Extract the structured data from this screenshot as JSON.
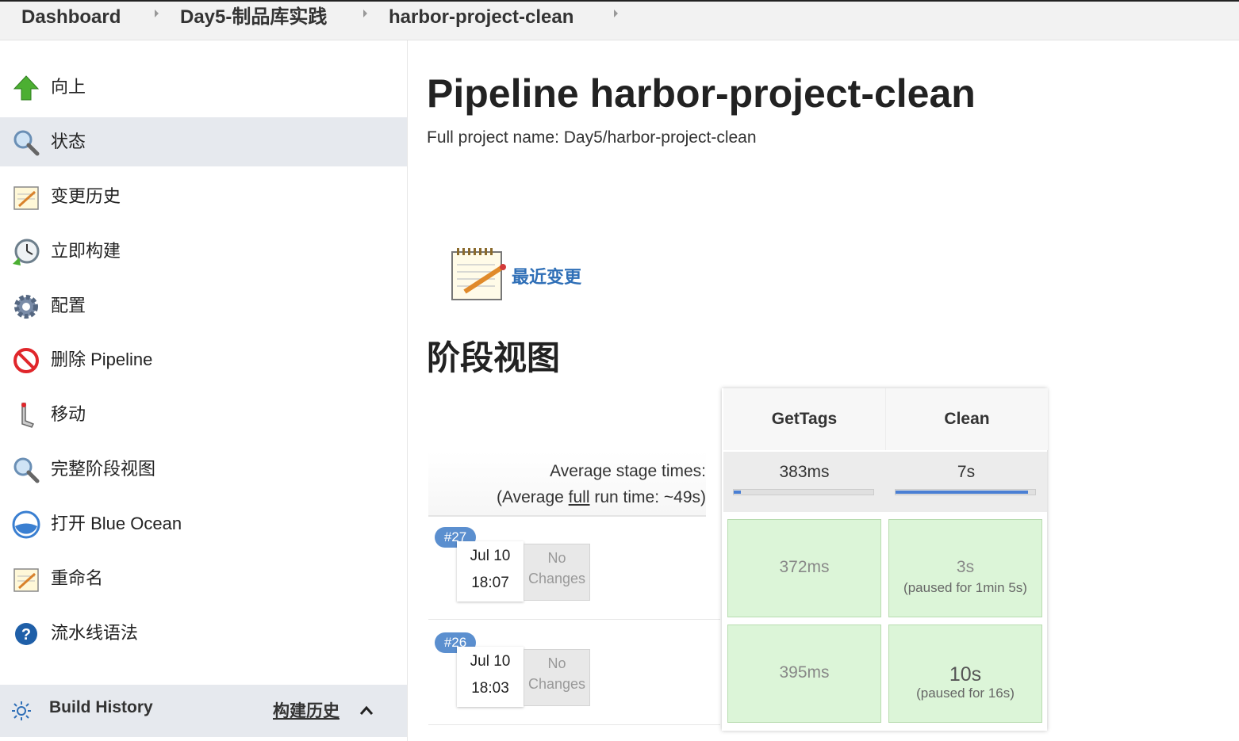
{
  "breadcrumb": {
    "items": [
      "Dashboard",
      "Day5-制品库实践",
      "harbor-project-clean"
    ]
  },
  "sidebar": {
    "items": [
      {
        "label": "向上",
        "icon": "up-arrow-icon"
      },
      {
        "label": "状态",
        "icon": "magnifier-icon",
        "active": true
      },
      {
        "label": "变更历史",
        "icon": "notepad-icon"
      },
      {
        "label": "立即构建",
        "icon": "clock-build-icon"
      },
      {
        "label": "配置",
        "icon": "gear-icon"
      },
      {
        "label": "删除 Pipeline",
        "icon": "no-entry-icon"
      },
      {
        "label": "移动",
        "icon": "move-icon"
      },
      {
        "label": "完整阶段视图",
        "icon": "magnifier-icon"
      },
      {
        "label": "打开 Blue Ocean",
        "icon": "blue-ocean-icon"
      },
      {
        "label": "重命名",
        "icon": "notepad-icon"
      },
      {
        "label": "流水线语法",
        "icon": "help-icon"
      }
    ],
    "build_history": {
      "label": "Build History",
      "link": "构建历史"
    }
  },
  "main": {
    "title": "Pipeline harbor-project-clean",
    "full_name": "Full project name: Day5/harbor-project-clean",
    "recent_changes": "最近变更",
    "stage_view_heading": "阶段视图"
  },
  "stage_view": {
    "stages": [
      "GetTags",
      "Clean"
    ],
    "average_label_line1": "Average stage times:",
    "average_label_line2_pre": "(Average ",
    "average_label_line2_link": "full",
    "average_label_line2_post": " run time: ~49s)",
    "averages": [
      {
        "time": "383ms",
        "fill": 0.05
      },
      {
        "time": "7s",
        "fill": 0.95
      }
    ],
    "runs": [
      {
        "badge": "#27",
        "date": "Jul 10",
        "time": "18:07",
        "changes_line1": "No",
        "changes_line2": "Changes",
        "cells": [
          {
            "time": "372ms",
            "pause": ""
          },
          {
            "time": "3s",
            "pause": "(paused for 1min 5s)"
          }
        ]
      },
      {
        "badge": "#26",
        "date": "Jul 10",
        "time": "18:03",
        "changes_line1": "No",
        "changes_line2": "Changes",
        "cells": [
          {
            "time": "395ms",
            "pause": ""
          },
          {
            "time": "10s",
            "pause": "(paused for 16s)"
          }
        ]
      }
    ]
  },
  "colors": {
    "accent_link": "#2f6fb7",
    "success_cell": "#dcf5d8",
    "badge": "#5b8fcf",
    "progress": "#4a7fd4"
  }
}
